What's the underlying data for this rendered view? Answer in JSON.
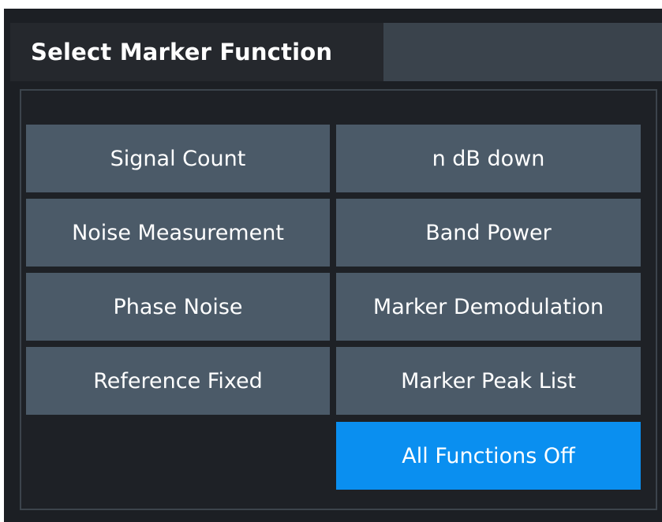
{
  "dialog": {
    "title": "Select Marker Function"
  },
  "buttons": {
    "signal_count": "Signal Count",
    "n_db_down": "n dB down",
    "noise_measurement": "Noise Measurement",
    "band_power": "Band Power",
    "phase_noise": "Phase Noise",
    "marker_demodulation": "Marker Demodulation",
    "reference_fixed": "Reference Fixed",
    "marker_peak_list": "Marker Peak List",
    "all_functions_off": "All Functions Off"
  },
  "colors": {
    "button": "#4b5a68",
    "active_button": "#0a8ff0",
    "background": "#1c1f24"
  }
}
